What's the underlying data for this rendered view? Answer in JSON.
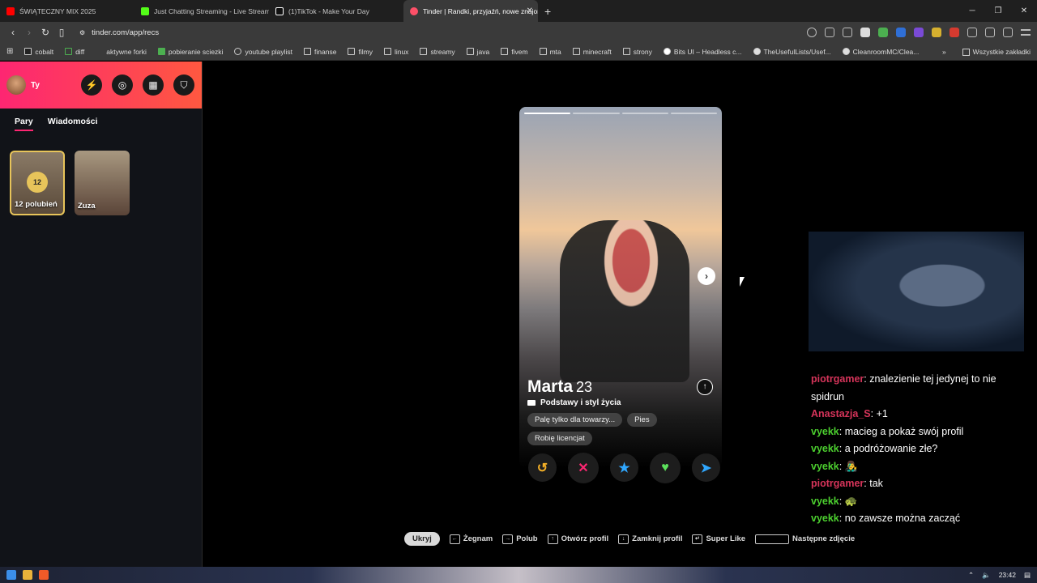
{
  "browser": {
    "tabs": [
      {
        "label": "ŚWIĄTECZNY MIX 2025",
        "color": "#ff0000"
      },
      {
        "label": "Just Chatting Streaming - Live Stream",
        "color": "#53fc18"
      },
      {
        "label": "(1)TikTok - Make Your Day",
        "color": "#ffffff"
      },
      {
        "label": "Tinder | Randki, przyjaźń, nowe znajomości",
        "color": "#fd5068",
        "active": true
      }
    ],
    "url": "tinder.com/app/recs",
    "bookmarks": [
      "cobalt",
      "diff",
      "aktywne forki",
      "pobieranie sciezki",
      "youtube playlist",
      "finanse",
      "filmy",
      "linux",
      "streamy",
      "java",
      "fivem",
      "mta",
      "minecraft",
      "strony",
      "Bits UI – Headless c...",
      "TheUsefulLists/Usef...",
      "CleanroomMC/Clea..."
    ],
    "bookmarks_all": "Wszystkie zakładki"
  },
  "sidebar": {
    "user_name": "Ty",
    "tabs": [
      "Pary",
      "Wiadomości"
    ],
    "likes_count": "12",
    "likes_label": "12 polubień",
    "match_name": "Zuza"
  },
  "card": {
    "name": "Marta",
    "age": "23",
    "section": "Podstawy i styl życia",
    "chips": [
      "Palę tylko dla towarzy...",
      "Pies",
      "Robię licencjat"
    ]
  },
  "actions": {
    "rewind_icon": "↺",
    "nope_icon": "✕",
    "superlike_icon": "★",
    "like_icon": "♥",
    "boost_icon": "➤"
  },
  "chat": [
    {
      "user": "piotrgamer",
      "color": "red",
      "text": ": znalezienie tej jedynej to nie spidrun"
    },
    {
      "user": "Anastazja_S",
      "color": "red",
      "text": ": +1"
    },
    {
      "user": "vyekk",
      "color": "green",
      "text": ": macieg a pokaż swój profil"
    },
    {
      "user": "vyekk",
      "color": "green",
      "text": ": a podróżowanie złe?"
    },
    {
      "user": "vyekk",
      "color": "green",
      "text": ": 👨‍🎤"
    },
    {
      "user": "piotrgamer",
      "color": "red",
      "text": ": tak"
    },
    {
      "user": "vyekk",
      "color": "green",
      "text": ": 🐢"
    },
    {
      "user": "vyekk",
      "color": "green",
      "text": ": no zawsze można zacząć"
    }
  ],
  "hints": {
    "hide": "Ukryj",
    "nope": "Żegnam",
    "like": "Polub",
    "open": "Otwórz profil",
    "close": "Zamknij profil",
    "superlike": "Super Like",
    "next_photo": "Następne zdjęcie"
  },
  "taskbar": {
    "time": "23:42"
  }
}
